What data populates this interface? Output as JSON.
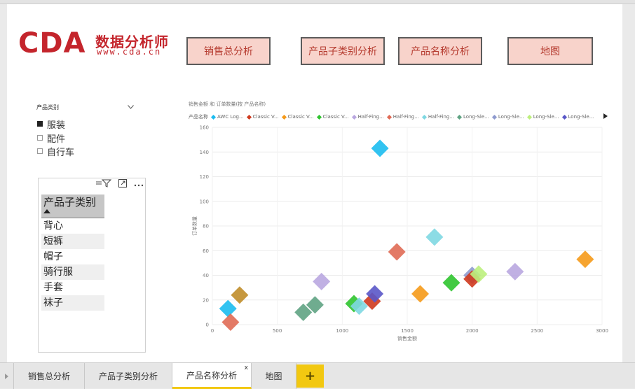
{
  "logo": {
    "brand": "CDA",
    "chinese": "数据分析师",
    "url": "www.cda.cn"
  },
  "nav": {
    "btn1": "销售总分析",
    "btn2": "产品子类别分析",
    "btn3": "产品名称分析",
    "btn4": "地图"
  },
  "slicer": {
    "title": "产品类别",
    "items": [
      {
        "label": "服装",
        "checked": true
      },
      {
        "label": "配件",
        "checked": false
      },
      {
        "label": "自行车",
        "checked": false
      }
    ]
  },
  "table": {
    "header": "产品子类别",
    "rows": [
      "背心",
      "短裤",
      "帽子",
      "骑行服",
      "手套",
      "袜子"
    ]
  },
  "tabs": {
    "tab1": "销售总分析",
    "tab2": "产品子类别分析",
    "tab3": "产品名称分析",
    "tab4": "地图",
    "close": "x",
    "add": "+"
  },
  "chart_data": {
    "type": "scatter",
    "title": "销售金额 和 订单数量(按 产品名称)",
    "legend_title": "产品名称",
    "xlabel": "销售金额",
    "ylabel": "订单数量",
    "xlim": [
      0,
      3000
    ],
    "ylim": [
      0,
      160
    ],
    "x_ticks": [
      "0",
      "500",
      "1000",
      "1500",
      "2000",
      "2500",
      "3000"
    ],
    "y_ticks": [
      "0",
      "20",
      "40",
      "60",
      "80",
      "100",
      "120",
      "140",
      "160"
    ],
    "grid": true,
    "legend": [
      {
        "name": "AWC Log...",
        "color": "#1cbcf0"
      },
      {
        "name": "Classic V...",
        "color": "#cf3a1e"
      },
      {
        "name": "Classic V...",
        "color": "#f59a1a"
      },
      {
        "name": "Classic V...",
        "color": "#2fc42f"
      },
      {
        "name": "Half-Fing...",
        "color": "#b9a7e0"
      },
      {
        "name": "Half-Fing...",
        "color": "#e06b55"
      },
      {
        "name": "Half-Fing...",
        "color": "#7fd8e2"
      },
      {
        "name": "Long-Sle...",
        "color": "#5fa383"
      },
      {
        "name": "Long-Sle...",
        "color": "#8f9bcf"
      },
      {
        "name": "Long-Sle...",
        "color": "#bdef7d"
      },
      {
        "name": "Long-Sle...",
        "color": "#5a57c8"
      }
    ],
    "points": [
      {
        "x": 1290,
        "y": 143,
        "color": "#1cbcf0"
      },
      {
        "x": 120,
        "y": 13,
        "color": "#1cbcf0"
      },
      {
        "x": 140,
        "y": 2,
        "color": "#e06b55"
      },
      {
        "x": 210,
        "y": 24,
        "color": "#c08d2a"
      },
      {
        "x": 700,
        "y": 10,
        "color": "#5fa383"
      },
      {
        "x": 790,
        "y": 16,
        "color": "#5fa383"
      },
      {
        "x": 840,
        "y": 35,
        "color": "#b9a7e0"
      },
      {
        "x": 1090,
        "y": 17,
        "color": "#2fc42f"
      },
      {
        "x": 1130,
        "y": 15,
        "color": "#7fd8e2"
      },
      {
        "x": 1230,
        "y": 19,
        "color": "#cf3a1e"
      },
      {
        "x": 1250,
        "y": 25,
        "color": "#5a57c8"
      },
      {
        "x": 1420,
        "y": 59,
        "color": "#e06b55"
      },
      {
        "x": 1600,
        "y": 25,
        "color": "#f59a1a"
      },
      {
        "x": 1710,
        "y": 71,
        "color": "#7fd8e2"
      },
      {
        "x": 1840,
        "y": 34,
        "color": "#2fc42f"
      },
      {
        "x": 2000,
        "y": 40,
        "color": "#8f9bcf"
      },
      {
        "x": 2000,
        "y": 37,
        "color": "#cf3a1e"
      },
      {
        "x": 2050,
        "y": 41,
        "color": "#bdef7d"
      },
      {
        "x": 2330,
        "y": 43,
        "color": "#b9a7e0"
      },
      {
        "x": 2870,
        "y": 53,
        "color": "#f59a1a"
      }
    ]
  }
}
